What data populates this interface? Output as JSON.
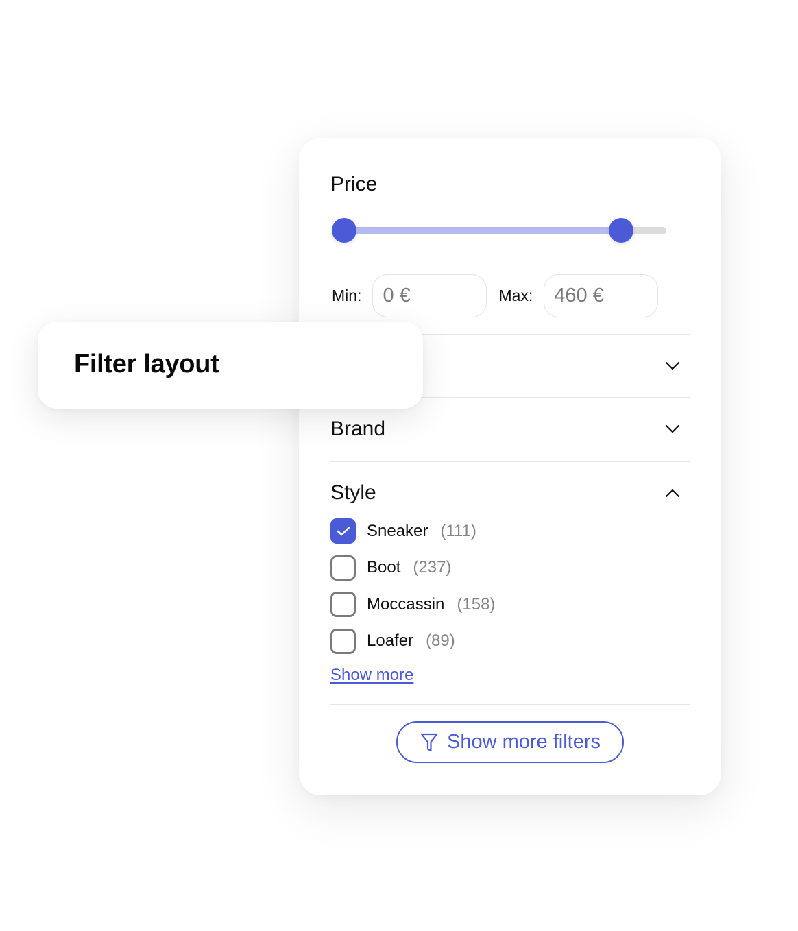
{
  "colors": {
    "accent": "#4b5bd7",
    "accent_light": "#b6bbee",
    "track": "#dcdcdc",
    "divider": "#e6e6e6",
    "muted_text": "#858585"
  },
  "overlay_card": {
    "title": "Filter layout"
  },
  "price": {
    "title": "Price",
    "slider": {
      "min_value": 0,
      "max_value": 460,
      "low_handle_fraction": 0.0,
      "high_handle_fraction": 0.86
    },
    "min_label": "Min:",
    "min_placeholder": "0 €",
    "max_label": "Max:",
    "max_placeholder": "460 €"
  },
  "sections": [
    {
      "title": "",
      "expanded": false,
      "icon": "chevron-down-icon"
    },
    {
      "title": "Brand",
      "expanded": false,
      "icon": "chevron-down-icon"
    },
    {
      "title": "Style",
      "expanded": true,
      "icon": "chevron-up-icon"
    }
  ],
  "style_options": [
    {
      "label": "Sneaker",
      "count": "(111)",
      "checked": true
    },
    {
      "label": "Boot",
      "count": "(237)",
      "checked": false
    },
    {
      "label": "Moccassin",
      "count": "(158)",
      "checked": false
    },
    {
      "label": "Loafer",
      "count": "(89)",
      "checked": false
    }
  ],
  "show_more_link": "Show more",
  "more_filters_button": {
    "label": "Show more filters",
    "icon": "filter-funnel-icon"
  }
}
